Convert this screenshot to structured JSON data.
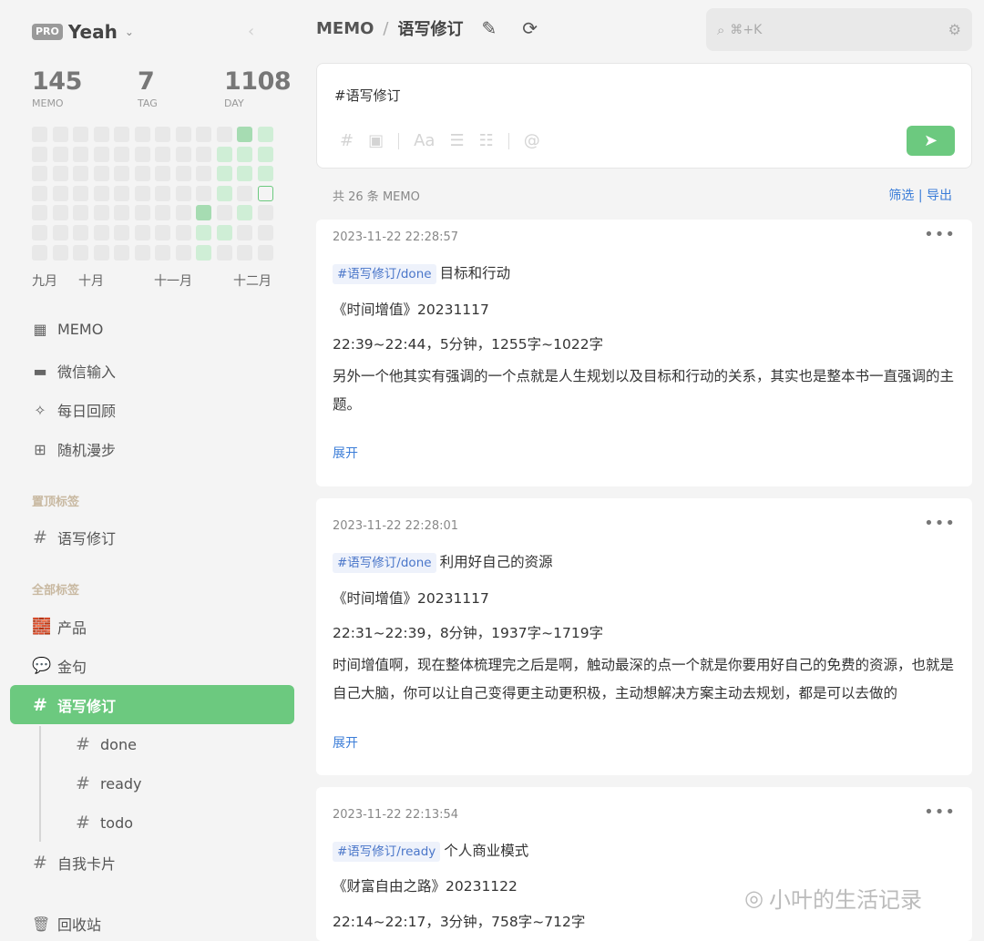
{
  "sidebar": {
    "pro_badge": "PRO",
    "brand": "Yeah",
    "caret": "⌄",
    "collapse": "‹",
    "stats": [
      {
        "value": "145",
        "label": "MEMO"
      },
      {
        "value": "7",
        "label": "TAG"
      },
      {
        "value": "1108",
        "label": "DAY"
      }
    ],
    "months": [
      "九月",
      "十月",
      "十一月",
      "十二月"
    ],
    "nav": [
      {
        "label": "MEMO",
        "icon": "▦"
      },
      {
        "label": "微信输入",
        "icon": "▬"
      },
      {
        "label": "每日回顾",
        "icon": "✧"
      },
      {
        "label": "随机漫步",
        "icon": "⊞"
      }
    ],
    "pinned_label": "置顶标签",
    "pinned_tags": [
      {
        "label": "语写修订",
        "icon": "#"
      }
    ],
    "all_label": "全部标签",
    "tags": [
      {
        "label": "产品",
        "icon": "🧱"
      },
      {
        "label": "金句",
        "icon": "💬"
      },
      {
        "label": "语写修订",
        "icon": "#"
      }
    ],
    "subtags": [
      {
        "label": "done",
        "icon": "#"
      },
      {
        "label": "ready",
        "icon": "#"
      },
      {
        "label": "todo",
        "icon": "#"
      }
    ],
    "extra_tag": {
      "label": "自我卡片",
      "icon": "#"
    },
    "trash": {
      "label": "回收站",
      "icon": "🗑"
    }
  },
  "header": {
    "root": "MEMO",
    "sep": "/",
    "page": "语写修订",
    "edit_icon": "✎",
    "refresh_icon": "⟳",
    "search_icon": "⌕",
    "search_placeholder": "⌘+K",
    "filter_icon": "⚙"
  },
  "editor": {
    "text": "#语写修订",
    "tools": [
      "#",
      "▣",
      "Aa",
      "☰",
      "☷",
      "@"
    ],
    "send_icon": "➤"
  },
  "summary": {
    "count_text": "共 26 条 MEMO",
    "filter": "筛选",
    "sep": "|",
    "export": "导出"
  },
  "cards": [
    {
      "time": "2023-11-22 22:28:57",
      "more": "•••",
      "tag": "#语写修订/done",
      "title": "目标和行动",
      "book": "《时间增值》20231117",
      "meta": "22:39~22:44，5分钟，1255字~1022字",
      "body": "另外一个他其实有强调的一个点就是人生规划以及目标和行动的关系，其实也是整本书一直强调的主题。",
      "expand": "展开"
    },
    {
      "time": "2023-11-22 22:28:01",
      "more": "•••",
      "tag": "#语写修订/done",
      "title": "利用好自己的资源",
      "book": "《时间增值》20231117",
      "meta": "22:31~22:39，8分钟，1937字~1719字",
      "body": "时间增值啊，现在整体梳理完之后是啊，触动最深的点一个就是你要用好自己的免费的资源，也就是自己大脑，你可以让自己变得更主动更积极，主动想解决方案主动去规划，都是可以去做的",
      "expand": "展开"
    },
    {
      "time": "2023-11-22 22:13:54",
      "more": "•••",
      "tag": "#语写修订/ready",
      "title": "个人商业模式",
      "book": "《财富自由之路》20231122",
      "meta": "22:14~22:17，3分钟，758字~712字"
    }
  ],
  "watermark": {
    "icon": "◎",
    "text": "小叶的生活记录"
  },
  "colors": {
    "accent_green": "#6cc97f",
    "heat_empty": "#e8e8e8",
    "heat_light": "#cfeed6",
    "heat_medium": "#a6dcb2",
    "link_blue": "#3b7dd8"
  },
  "heatmap": {
    "rows": 7,
    "cols": 12,
    "levels": [
      [
        0,
        0,
        0,
        0,
        0,
        0,
        0,
        0,
        0,
        0,
        2,
        1
      ],
      [
        0,
        0,
        0,
        0,
        0,
        0,
        0,
        0,
        0,
        1,
        1,
        1
      ],
      [
        0,
        0,
        0,
        0,
        0,
        0,
        0,
        0,
        0,
        1,
        1,
        1
      ],
      [
        0,
        0,
        0,
        0,
        0,
        0,
        0,
        0,
        0,
        1,
        0,
        3
      ],
      [
        0,
        0,
        0,
        0,
        0,
        0,
        0,
        0,
        2,
        0,
        1,
        0
      ],
      [
        0,
        0,
        0,
        0,
        0,
        0,
        0,
        0,
        1,
        1,
        0,
        0
      ],
      [
        0,
        0,
        0,
        0,
        0,
        0,
        0,
        0,
        1,
        0,
        0,
        0
      ]
    ]
  }
}
